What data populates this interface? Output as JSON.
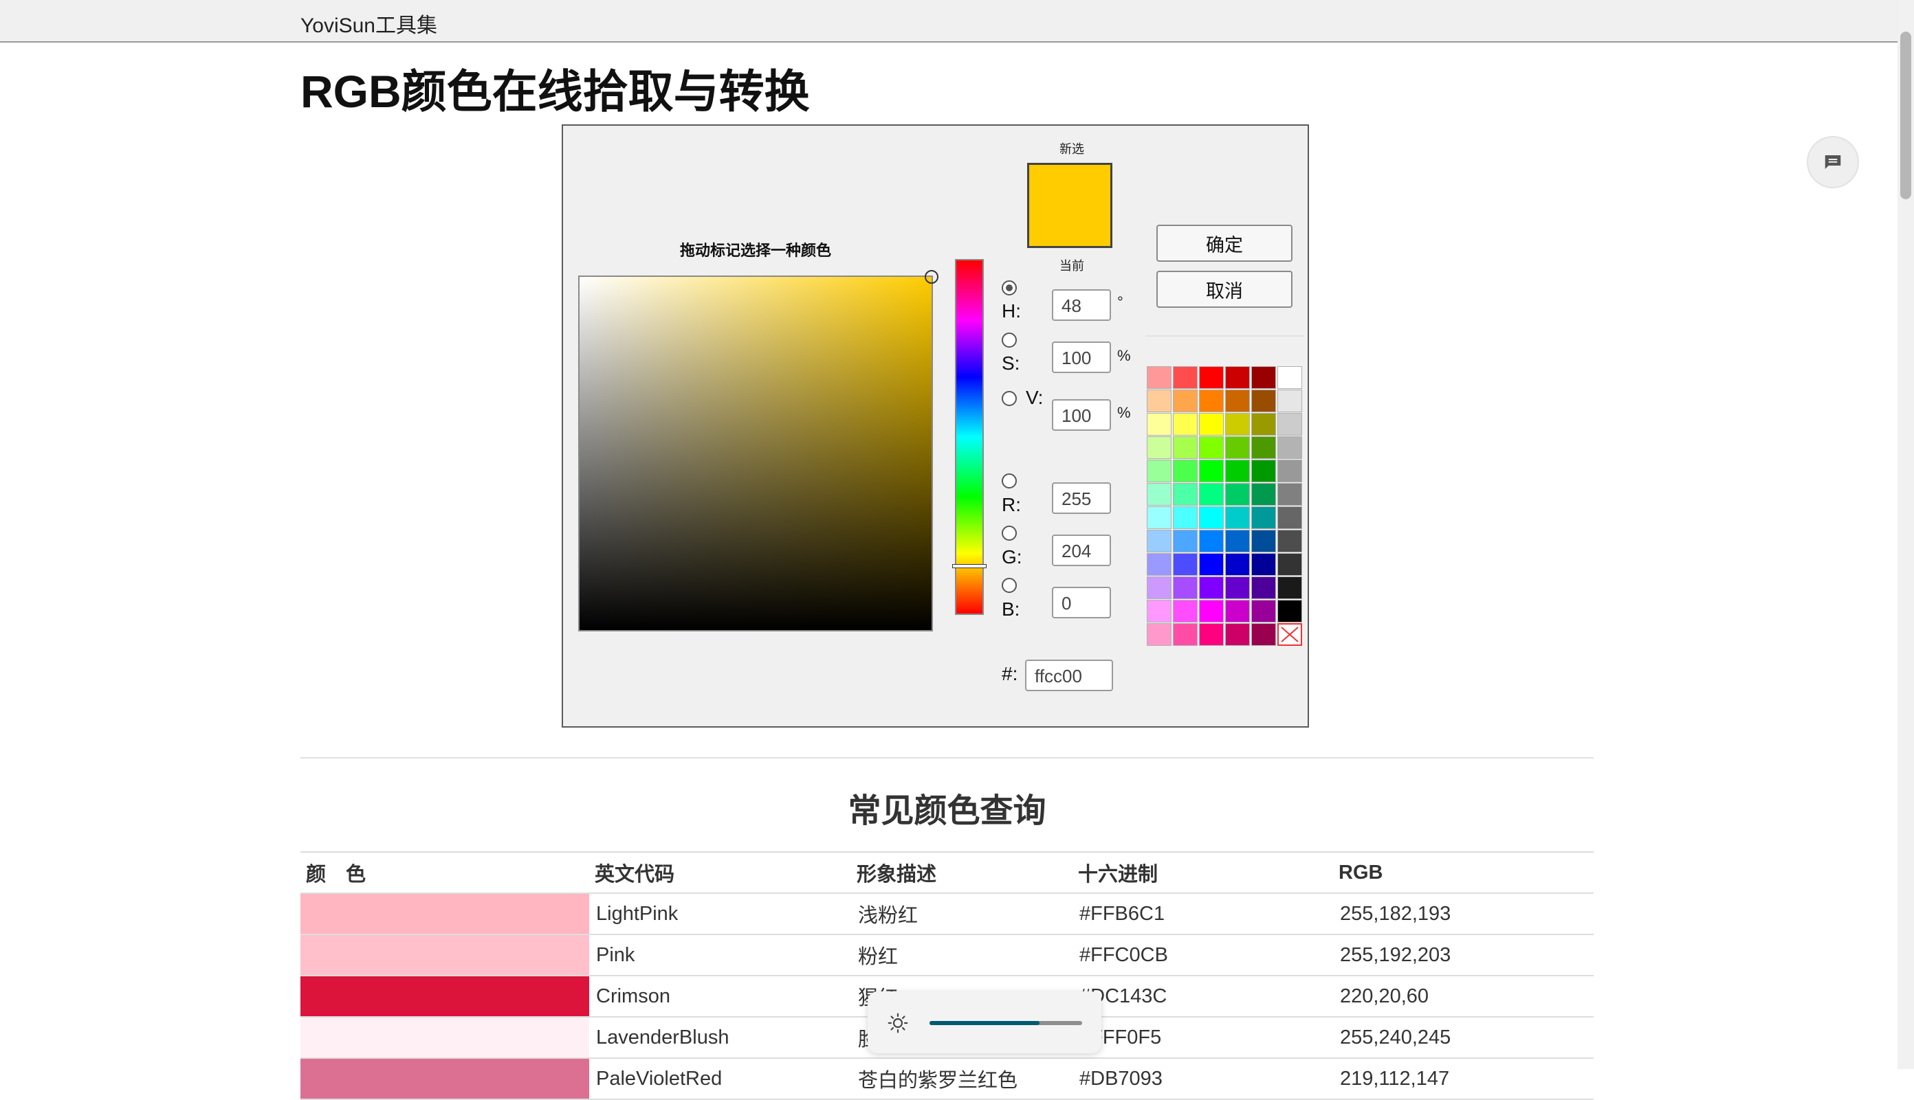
{
  "topbar": {
    "brand": "YoviSun工具集"
  },
  "page_title": "RGB颜色在线拾取与转换",
  "picker": {
    "sv_caption": "拖动标记选择一种颜色",
    "new_label": "新选",
    "current_label": "当前",
    "selected_color": "#ffcc00",
    "fields": {
      "h": {
        "label": "H:",
        "value": "48",
        "unit": "°"
      },
      "s": {
        "label": "S:",
        "value": "100",
        "unit": "%"
      },
      "v": {
        "label": "V:",
        "value": "100",
        "unit": "%"
      },
      "r": {
        "label": "R:",
        "value": "255"
      },
      "g": {
        "label": "G:",
        "value": "204"
      },
      "b": {
        "label": "B:",
        "value": "0"
      },
      "hex": {
        "label": "#:",
        "value": "ffcc00"
      }
    },
    "active_mode": "h",
    "ok_label": "确定",
    "cancel_label": "取消",
    "palette": [
      [
        "#ff9999",
        "#ff4d4d",
        "#ff0000",
        "#cc0000",
        "#990000",
        "#ffffff"
      ],
      [
        "#ffcc99",
        "#ffa64d",
        "#ff8000",
        "#cc6600",
        "#994d00",
        "#e6e6e6"
      ],
      [
        "#ffff99",
        "#ffff4d",
        "#ffff00",
        "#cccc00",
        "#999900",
        "#cccccc"
      ],
      [
        "#ccff99",
        "#a6ff4d",
        "#80ff00",
        "#66cc00",
        "#4d9900",
        "#b3b3b3"
      ],
      [
        "#99ff99",
        "#4dff4d",
        "#00ff00",
        "#00cc00",
        "#009900",
        "#999999"
      ],
      [
        "#99ffcc",
        "#4dffa6",
        "#00ff80",
        "#00cc66",
        "#00994d",
        "#808080"
      ],
      [
        "#99ffff",
        "#4dffff",
        "#00ffff",
        "#00cccc",
        "#009999",
        "#666666"
      ],
      [
        "#99ccff",
        "#4da6ff",
        "#0080ff",
        "#0066cc",
        "#004d99",
        "#4d4d4d"
      ],
      [
        "#9999ff",
        "#4d4dff",
        "#0000ff",
        "#0000cc",
        "#000099",
        "#333333"
      ],
      [
        "#cc99ff",
        "#a64dff",
        "#8000ff",
        "#6600cc",
        "#4d0099",
        "#1a1a1a"
      ],
      [
        "#ff99ff",
        "#ff4dff",
        "#ff00ff",
        "#cc00cc",
        "#990099",
        "#000000"
      ],
      [
        "#ff99cc",
        "#ff4da6",
        "#ff0080",
        "#cc0066",
        "#99004d",
        "none"
      ]
    ]
  },
  "section_title": "常见颜色查询",
  "table": {
    "headers": [
      "颜　色",
      "英文代码",
      "形象描述",
      "十六进制",
      "RGB"
    ],
    "rows": [
      {
        "color": "#FFB6C1",
        "name": "LightPink",
        "desc": "浅粉红",
        "hex": "#FFB6C1",
        "rgb": "255,182,193"
      },
      {
        "color": "#FFC0CB",
        "name": "Pink",
        "desc": "粉红",
        "hex": "#FFC0CB",
        "rgb": "255,192,203"
      },
      {
        "color": "#DC143C",
        "name": "Crimson",
        "desc": "猩红",
        "hex": "#DC143C",
        "rgb": "220,20,60"
      },
      {
        "color": "#FFF0F5",
        "name": "LavenderBlush",
        "desc": "脸红的淡紫色",
        "hex": "#FFF0F5",
        "rgb": "255,240,245"
      },
      {
        "color": "#DB7093",
        "name": "PaleVioletRed",
        "desc": "苍白的紫罗兰红色",
        "hex": "#DB7093",
        "rgb": "219,112,147"
      }
    ]
  },
  "brightness": {
    "level": 0.72,
    "icon": "sun-icon"
  }
}
